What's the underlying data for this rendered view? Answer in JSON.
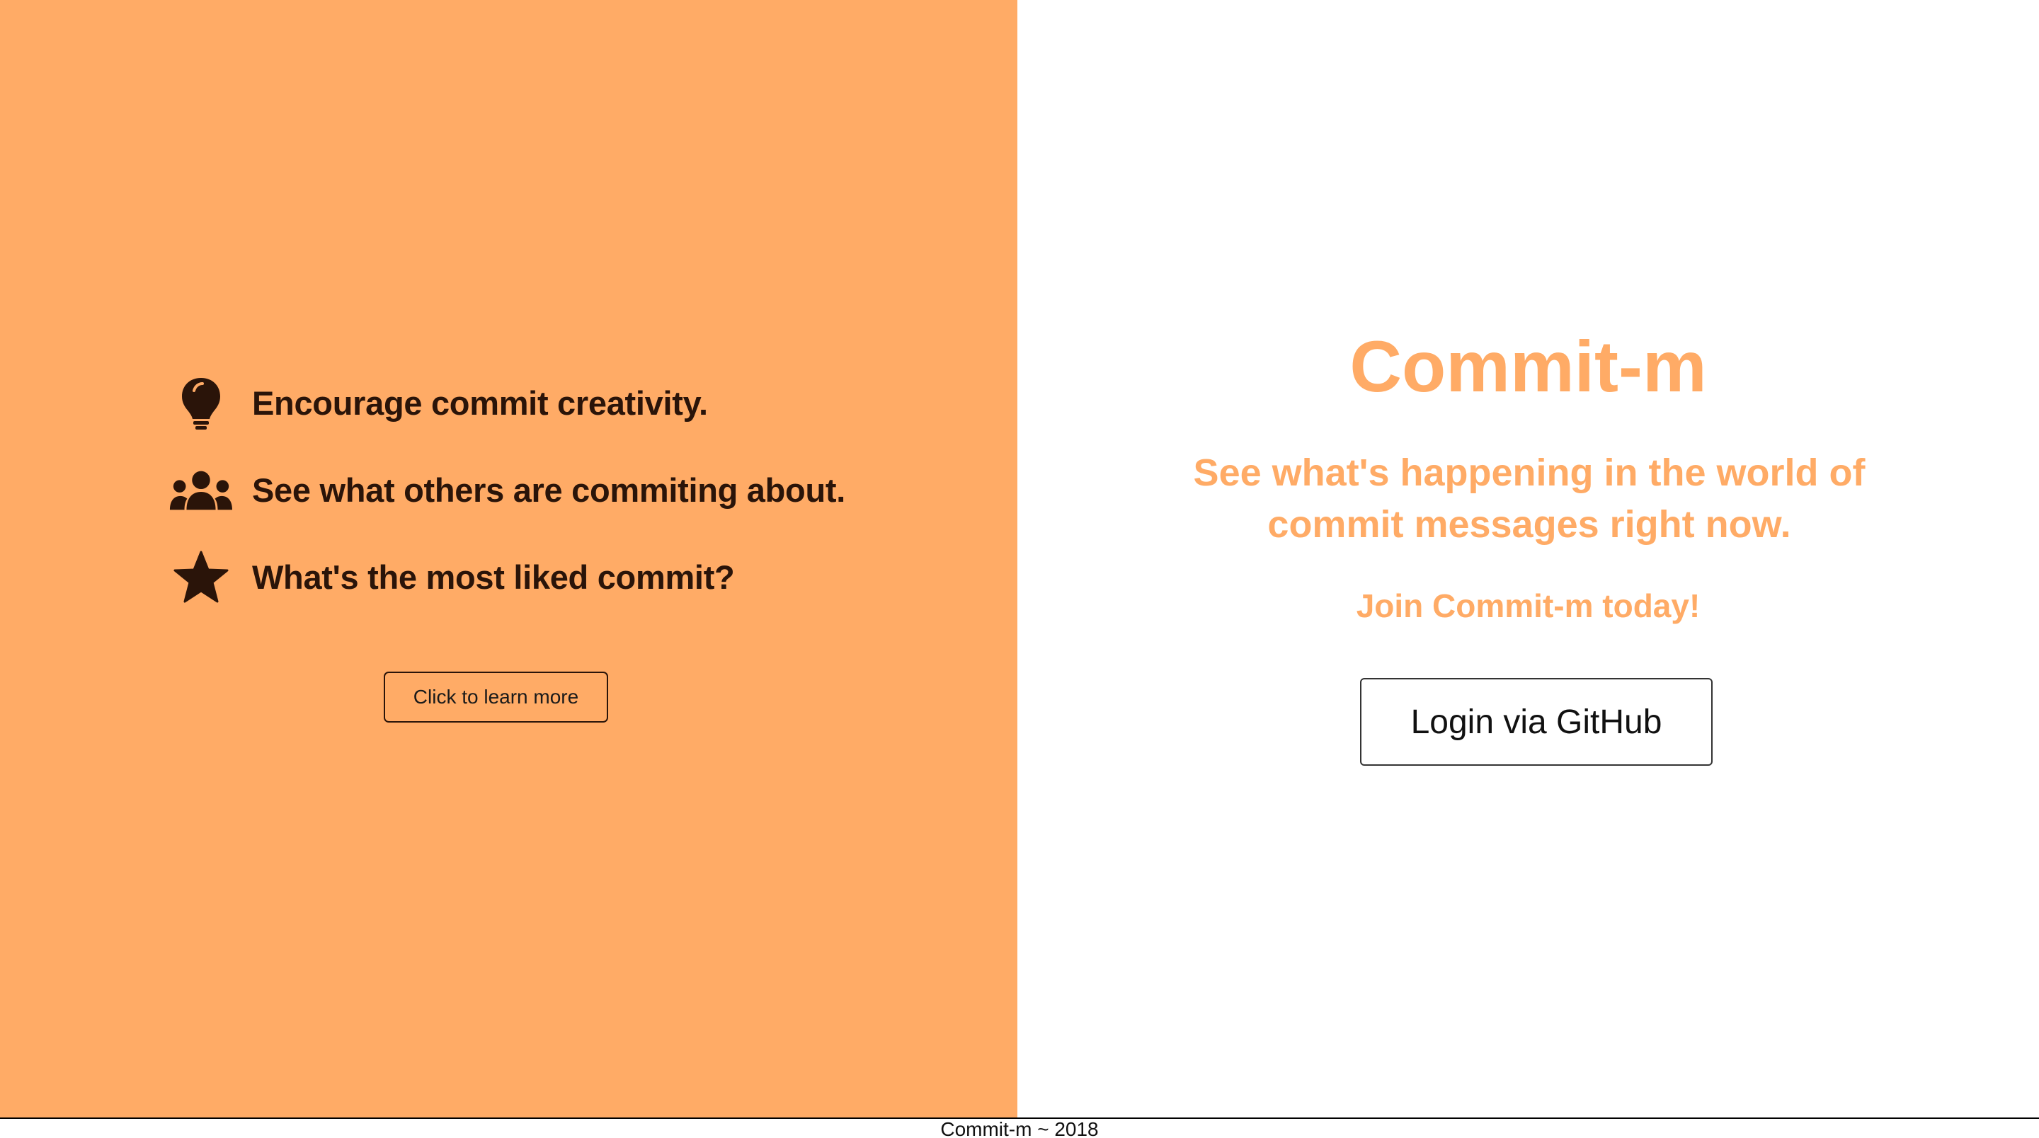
{
  "colors": {
    "accent": "#ffab66",
    "dark_text": "#2a1409",
    "background": "#ffffff"
  },
  "features": [
    {
      "icon": "lightbulb-icon",
      "text": "Encourage commit creativity."
    },
    {
      "icon": "users-icon",
      "text": "See what others are commiting about."
    },
    {
      "icon": "star-icon",
      "text": "What's the most liked commit?"
    }
  ],
  "learn_more": {
    "label": "Click to learn more"
  },
  "hero": {
    "title": "Commit-m",
    "tagline": "See what's happening in the world of commit messages right now.",
    "join": "Join Commit-m today!",
    "login_label": "Login via GitHub"
  },
  "footer": {
    "text": "Commit-m ~ 2018"
  }
}
